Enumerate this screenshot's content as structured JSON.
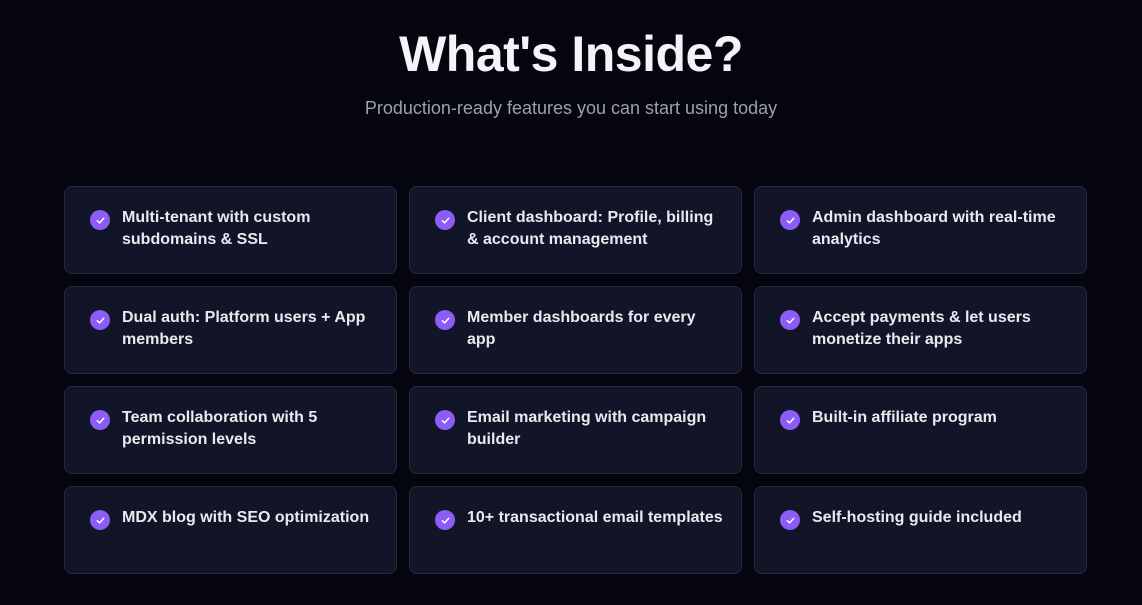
{
  "header": {
    "title": "What's Inside?",
    "subtitle": "Production-ready features you can start using today"
  },
  "colors": {
    "background": "#05050f",
    "card": "#111527",
    "card_border": "#252a3c",
    "accent": "#8b5cf6"
  },
  "features": [
    {
      "label": "Multi-tenant with custom subdomains & SSL",
      "icon": "check-circle-icon"
    },
    {
      "label": "Client dashboard: Profile, billing & account management",
      "icon": "check-circle-icon"
    },
    {
      "label": "Admin dashboard with real-time analytics",
      "icon": "check-circle-icon"
    },
    {
      "label": "Dual auth: Platform users + App members",
      "icon": "check-circle-icon"
    },
    {
      "label": "Member dashboards for every app",
      "icon": "check-circle-icon"
    },
    {
      "label": "Accept payments & let users monetize their apps",
      "icon": "check-circle-icon"
    },
    {
      "label": "Team collaboration with 5 permission levels",
      "icon": "check-circle-icon"
    },
    {
      "label": "Email marketing with campaign builder",
      "icon": "check-circle-icon"
    },
    {
      "label": "Built-in affiliate program",
      "icon": "check-circle-icon"
    },
    {
      "label": "MDX blog with SEO optimization",
      "icon": "check-circle-icon"
    },
    {
      "label": "10+ transactional email templates",
      "icon": "check-circle-icon"
    },
    {
      "label": "Self-hosting guide included",
      "icon": "check-circle-icon"
    }
  ]
}
